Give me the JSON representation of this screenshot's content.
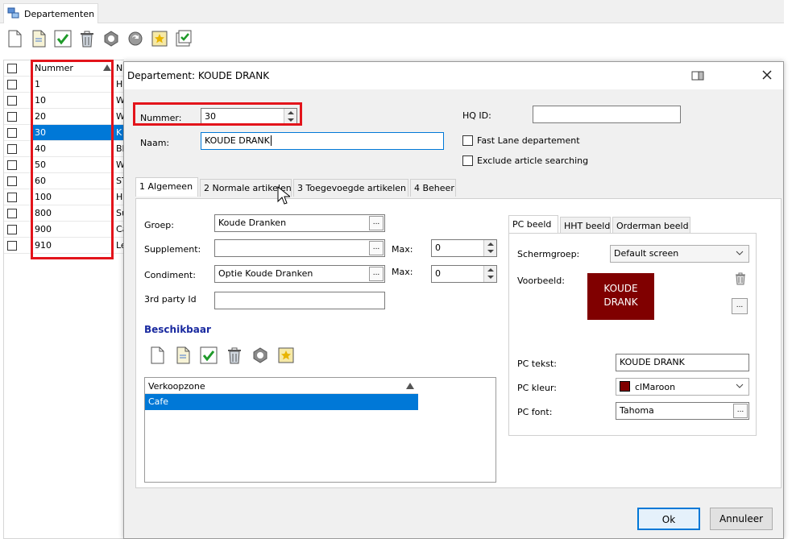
{
  "window_tab": {
    "title": "Departementen"
  },
  "main_toolbar": {
    "icons": [
      "new-icon",
      "edit-icon",
      "confirm-icon",
      "delete-icon",
      "refresh-shield-icon",
      "sync-icon",
      "favorite-icon",
      "check-list-icon"
    ]
  },
  "department_list": {
    "col_number": "Nummer",
    "col_name_partial": "N",
    "rows": [
      {
        "number": "1",
        "name": "H"
      },
      {
        "number": "10",
        "name": "W"
      },
      {
        "number": "20",
        "name": "W"
      },
      {
        "number": "30",
        "name": "K"
      },
      {
        "number": "40",
        "name": "Bl"
      },
      {
        "number": "50",
        "name": "W"
      },
      {
        "number": "60",
        "name": "ST"
      },
      {
        "number": "100",
        "name": "H"
      },
      {
        "number": "800",
        "name": "Su"
      },
      {
        "number": "900",
        "name": "Ca"
      },
      {
        "number": "910",
        "name": "Le"
      }
    ]
  },
  "dialog": {
    "title": "Departement: KOUDE DRANK",
    "nummer_label": "Nummer:",
    "nummer_value": "30",
    "naam_label": "Naam:",
    "naam_value": "KOUDE DRANK",
    "hq_label": "HQ ID:",
    "hq_value": "",
    "fast_lane_label": "Fast Lane departement",
    "exclude_label": "Exclude article searching",
    "tabs": [
      "1 Algemeen",
      "2 Normale artikelen",
      "3 Toegevoegde artikelen",
      "4 Beheer"
    ],
    "groep_label": "Groep:",
    "groep_value": "Koude Dranken",
    "supplement_label": "Supplement:",
    "supplement_value": "",
    "max_label": "Max:",
    "supplement_max": "0",
    "condiment_label": "Condiment:",
    "condiment_value": "Optie Koude Dranken",
    "condiment_max": "0",
    "third_party_label": "3rd party Id",
    "third_party_value": "",
    "beschikbaar_title": "Beschikbaar",
    "verkoopzone_header": "Verkoopzone",
    "verkoopzones": [
      "Cafe"
    ],
    "right_tabs": [
      "PC beeld",
      "HHT beeld",
      "Orderman beeld"
    ],
    "schermgroep_label": "Schermgroep:",
    "schermgroep_value": "Default screen",
    "voorbeeld_label": "Voorbeeld:",
    "preview_line1": "KOUDE",
    "preview_line2": "DRANK",
    "preview_color": "#800000",
    "pc_tekst_label": "PC tekst:",
    "pc_tekst_value": "KOUDE DRANK",
    "pc_kleur_label": "PC kleur:",
    "pc_kleur_value": "clMaroon",
    "pc_font_label": "PC font:",
    "pc_font_value": "Tahoma",
    "ok_label": "Ok",
    "cancel_label": "Annuleer"
  },
  "colors": {
    "selection": "#0078d7",
    "highlight_box": "#e3141b",
    "section_title": "#1a2aa0"
  }
}
